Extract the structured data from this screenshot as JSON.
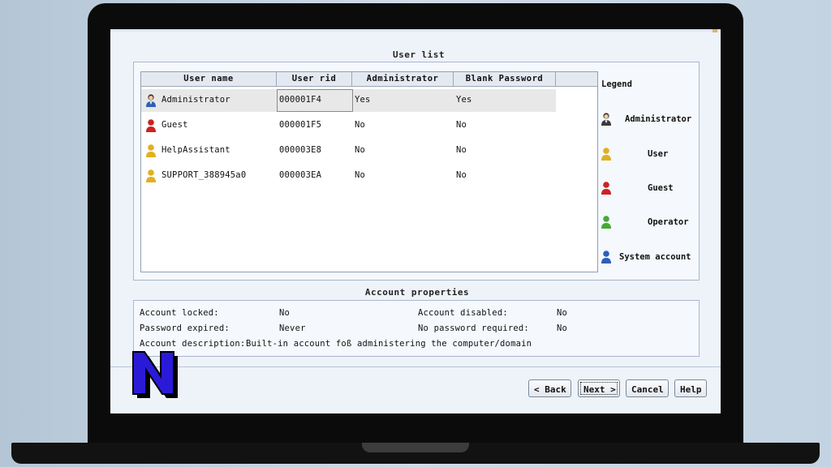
{
  "user_list": {
    "title": "User list",
    "columns": [
      "User name",
      "User rid",
      "Administrator",
      "Blank Password"
    ],
    "rows": [
      {
        "name": "Administrator",
        "rid": "000001F4",
        "admin": "Yes",
        "blank": "Yes",
        "icon": "administrator-user-icon",
        "selected": true
      },
      {
        "name": "Guest",
        "rid": "000001F5",
        "admin": "No",
        "blank": "No",
        "icon": "guest-user-icon",
        "selected": false
      },
      {
        "name": "HelpAssistant",
        "rid": "000003E8",
        "admin": "No",
        "blank": "No",
        "icon": "user-icon",
        "selected": false
      },
      {
        "name": "SUPPORT_388945a0",
        "rid": "000003EA",
        "admin": "No",
        "blank": "No",
        "icon": "user-icon",
        "selected": false
      }
    ]
  },
  "legend": {
    "title": "Legend",
    "items": [
      {
        "label": "Administrator",
        "icon": "administrator-user-icon",
        "color": "#3a3a3a"
      },
      {
        "label": "User",
        "icon": "user-icon",
        "color": "#e0b020"
      },
      {
        "label": "Guest",
        "icon": "guest-user-icon",
        "color": "#cc2222"
      },
      {
        "label": "Operator",
        "icon": "operator-user-icon",
        "color": "#44aa33"
      },
      {
        "label": "System account",
        "icon": "system-account-icon",
        "color": "#2e5fb8"
      }
    ]
  },
  "account_properties": {
    "title": "Account properties",
    "locked_label": "Account locked:",
    "locked_value": "No",
    "disabled_label": "Account disabled:",
    "disabled_value": "No",
    "expired_label": "Password expired:",
    "expired_value": "Never",
    "no_password_label": "No password required:",
    "no_password_value": "No",
    "description_label": "Account description:",
    "description_value": "Built-in account foß administering the computer/domain"
  },
  "buttons": {
    "back": "< Back",
    "next": "Next >",
    "cancel": "Cancel",
    "help": "Help"
  },
  "logo": {
    "letter": "N",
    "fill": "#2a1ad8"
  }
}
